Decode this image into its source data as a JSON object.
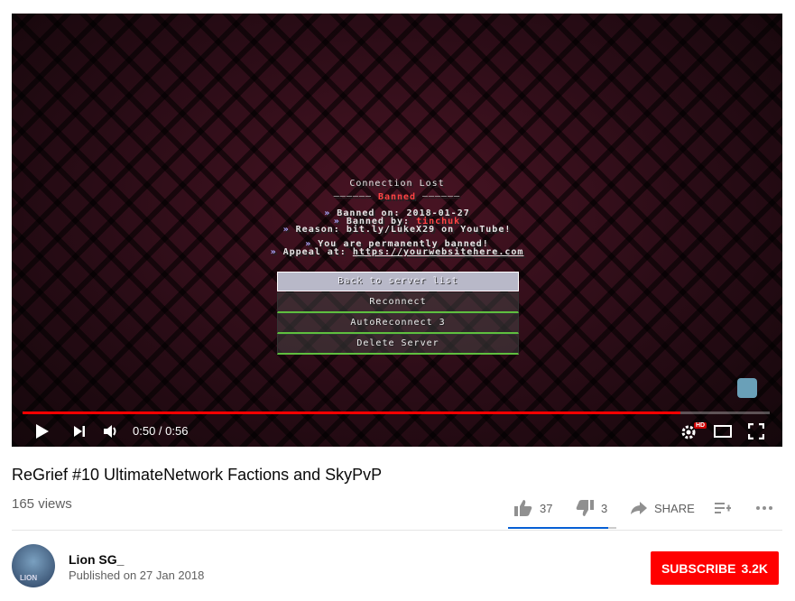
{
  "video": {
    "screen": {
      "title": "Connection Lost",
      "banned_header": "Banned",
      "lines": [
        {
          "label": "Banned on: ",
          "value": "2018-01-27"
        },
        {
          "label": "Banned by: ",
          "value": "tinchuk"
        },
        {
          "label": "Reason: ",
          "value": "bit.ly/LukeX29 on YouTube!"
        },
        {
          "label": "You are permanently banned!",
          "value": ""
        },
        {
          "label": "Appeal at: ",
          "value": "https://yourwebsitehere.com"
        }
      ],
      "buttons": [
        "Back to server list",
        "Reconnect",
        "AutoReconnect 3",
        "Delete Server"
      ]
    },
    "progress": 0.88,
    "time_current": "0:50",
    "time_sep": " / ",
    "time_total": "0:56",
    "hd_badge": "HD",
    "icons": [
      "play-icon",
      "next-icon",
      "volume-icon",
      "settings-icon",
      "theater-icon",
      "fullscreen-icon"
    ]
  },
  "info": {
    "title": "ReGrief #10 UltimateNetwork Factions and SkyPvP",
    "views": "165 views",
    "likes": "37",
    "dislikes": "3",
    "share_label": "SHARE",
    "like_ratio": 0.925
  },
  "channel": {
    "name": "Lion SG_",
    "avatar_text": "LION",
    "published": "Published on 27 Jan 2018",
    "subscribe_label": "SUBSCRIBE",
    "subscriber_count": "3.2K"
  },
  "colors": {
    "brand_red": "#ff0000",
    "like_blue": "#065fd4"
  }
}
